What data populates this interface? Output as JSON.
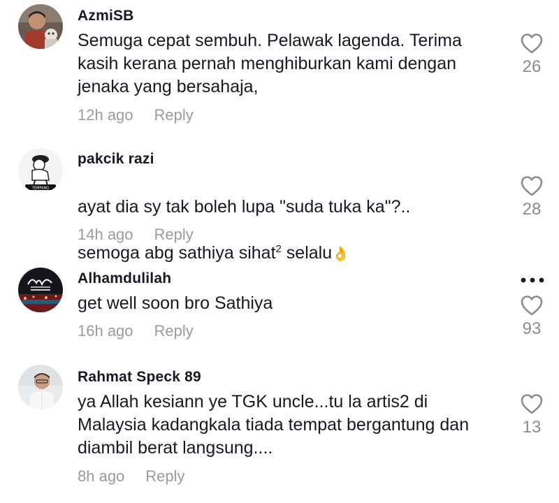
{
  "comments": [
    {
      "username": "AzmiSB",
      "text": "Semuga cepat sembuh. Pelawak lagenda. Terima\nkasih kerana pernah menghiburkan kami dengan\njenaka yang bersahaja,",
      "time": "12h ago",
      "reply_label": "Reply",
      "likes": "26"
    },
    {
      "username": "pakcik razi",
      "text_line1": "ayat dia sy tak boleh lupa \"suda tuka ka\"?..",
      "text_line2_a": "semoga abg sathiya sihat",
      "text_line2_sup": "2",
      "text_line2_b": " selalu",
      "emoji": "👌",
      "time": "14h ago",
      "reply_label": "Reply",
      "likes": "28"
    },
    {
      "username": "Alhamdulilah",
      "text": "get well soon bro Sathiya",
      "time": "16h ago",
      "reply_label": "Reply",
      "likes": "93"
    },
    {
      "username": "Rahmat Speck 89",
      "text": "ya Allah kesiann ye TGK uncle...tu la artis2 di\nMalaysia kadangkala tiada tempat bergantung dan\ndiambil berat langsung....",
      "time": "8h ago",
      "reply_label": "Reply",
      "likes": "13"
    }
  ],
  "icons": {
    "like": "heart-outline-icon",
    "more": "more-options-icon"
  },
  "colors": {
    "text": "#161823",
    "meta": "#9a9a9f",
    "count": "#8a8b91"
  }
}
